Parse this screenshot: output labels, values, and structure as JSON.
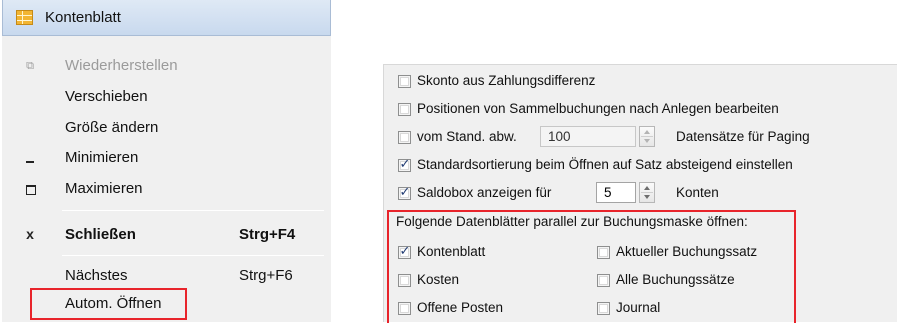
{
  "system_menu": {
    "title": "Kontenblatt",
    "items": [
      {
        "label": "Wiederherstellen",
        "icon": "restore-icon",
        "disabled": true
      },
      {
        "label": "Verschieben"
      },
      {
        "label": "Größe ändern"
      },
      {
        "label": "Minimieren",
        "icon": "minimize-icon"
      },
      {
        "label": "Maximieren",
        "icon": "maximize-icon"
      },
      {
        "label": "Schließen",
        "shortcut": "Strg+F4",
        "icon": "close-icon",
        "bold": true
      },
      {
        "label": "Nächstes",
        "shortcut": "Strg+F6"
      },
      {
        "label": "Autom. Öffnen",
        "highlighted": true
      }
    ]
  },
  "options": {
    "skonto": {
      "label": "Skonto aus Zahlungsdifferenz",
      "checked": false
    },
    "positionen": {
      "label": "Positionen von Sammelbuchungen nach Anlegen bearbeiten",
      "checked": false
    },
    "paging": {
      "label": "vom Stand. abw.",
      "value": "100",
      "suffix": "Datensätze für Paging",
      "checked": false
    },
    "sortierung": {
      "label": "Standardsortierung beim Öffnen auf Satz absteigend einstellen",
      "checked": true
    },
    "saldobox": {
      "label": "Saldobox anzeigen für",
      "value": "5",
      "suffix": "Konten",
      "checked": true
    },
    "parallel_heading": "Folgende Datenblätter parallel zur Buchungsmaske öffnen:",
    "parallel_items": [
      {
        "label": "Kontenblatt",
        "checked": true
      },
      {
        "label": "Kosten",
        "checked": false
      },
      {
        "label": "Offene Posten",
        "checked": false
      },
      {
        "label": "Aktueller Buchungssatz",
        "checked": false
      },
      {
        "label": "Alle Buchungssätze",
        "checked": false
      },
      {
        "label": "Journal",
        "checked": false
      }
    ]
  },
  "colors": {
    "highlight_border": "#e8242b",
    "menu_background": "#f0f0f0",
    "check": "#233d74"
  }
}
